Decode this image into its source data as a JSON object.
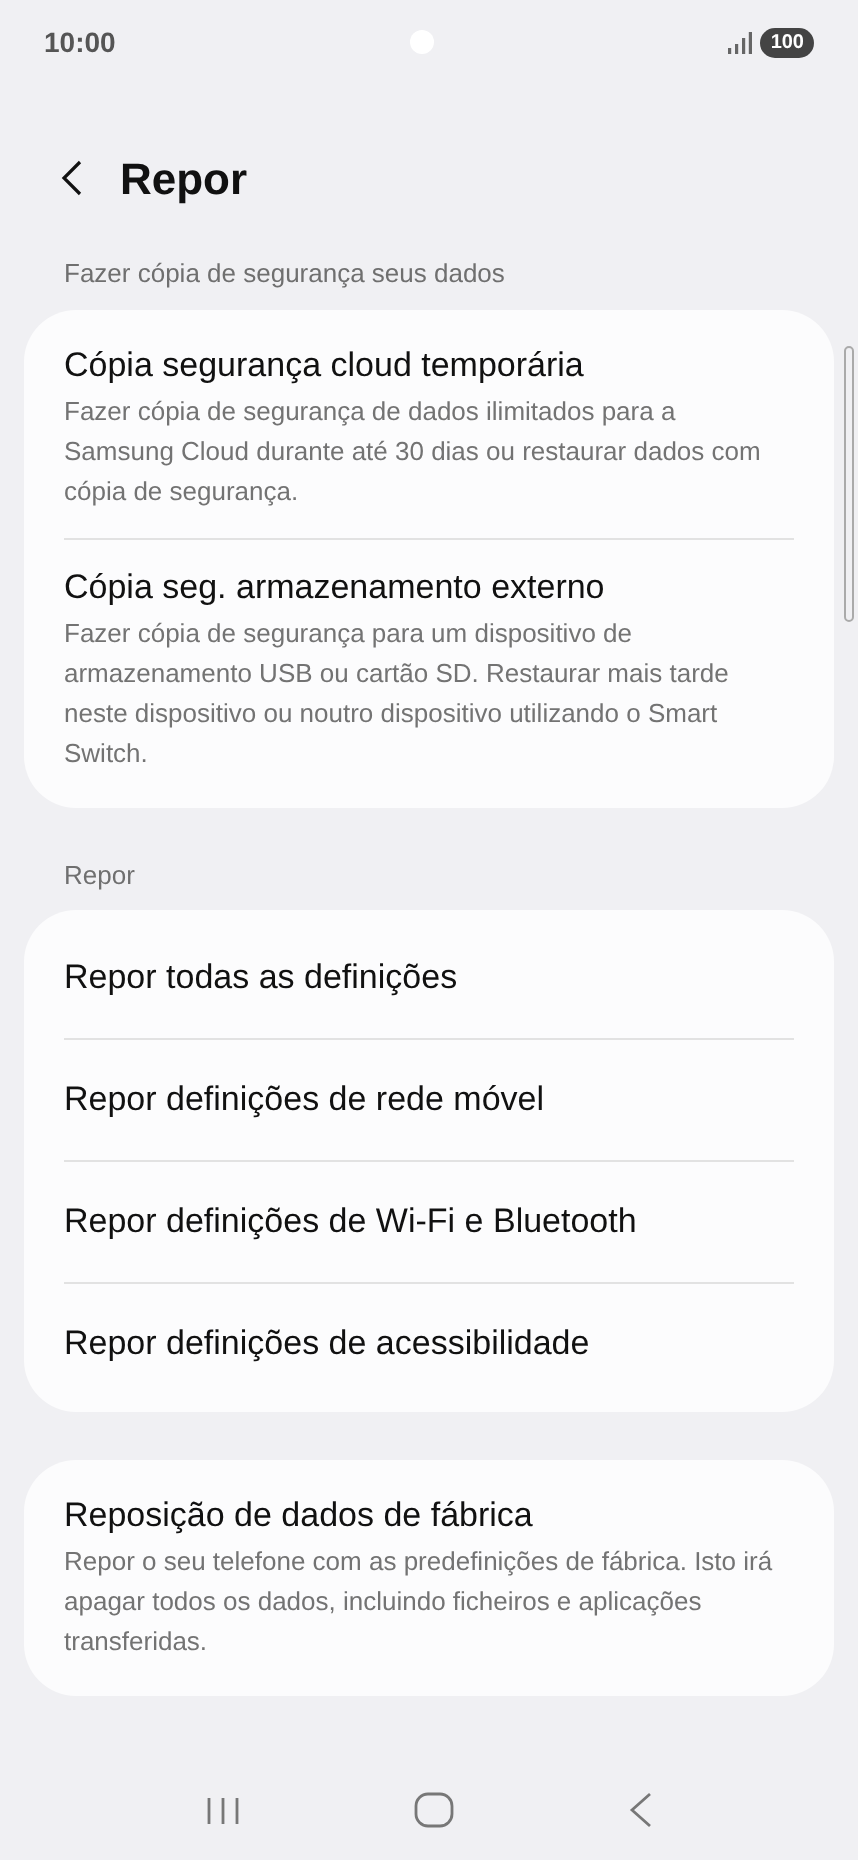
{
  "status_bar": {
    "time": "10:00",
    "battery": "100"
  },
  "header": {
    "title": "Repor"
  },
  "sections": [
    {
      "label": "Fazer cópia de segurança seus dados",
      "items": [
        {
          "title": "Cópia segurança cloud temporária",
          "subtitle": "Fazer cópia de segurança de dados ilimitados para a Samsung Cloud durante até 30 dias ou restaurar dados com cópia de segurança."
        },
        {
          "title": "Cópia seg. armazenamento externo",
          "subtitle": "Fazer cópia de segurança para um dispositivo de armazenamento USB ou cartão SD. Restaurar mais tarde neste dispositivo ou noutro dispositivo utilizando o Smart Switch."
        }
      ]
    },
    {
      "label": "Repor",
      "items": [
        {
          "title": "Repor todas as definições"
        },
        {
          "title": "Repor definições de rede móvel"
        },
        {
          "title": "Repor definições de Wi-Fi e Bluetooth"
        },
        {
          "title": "Repor definições de acessibilidade"
        }
      ]
    },
    {
      "items": [
        {
          "title": "Reposição de dados de fábrica",
          "subtitle": "Repor o seu telefone com as predefinições de fábrica. Isto irá apagar todos os dados, incluindo ficheiros e aplicações transferidas."
        }
      ]
    }
  ]
}
